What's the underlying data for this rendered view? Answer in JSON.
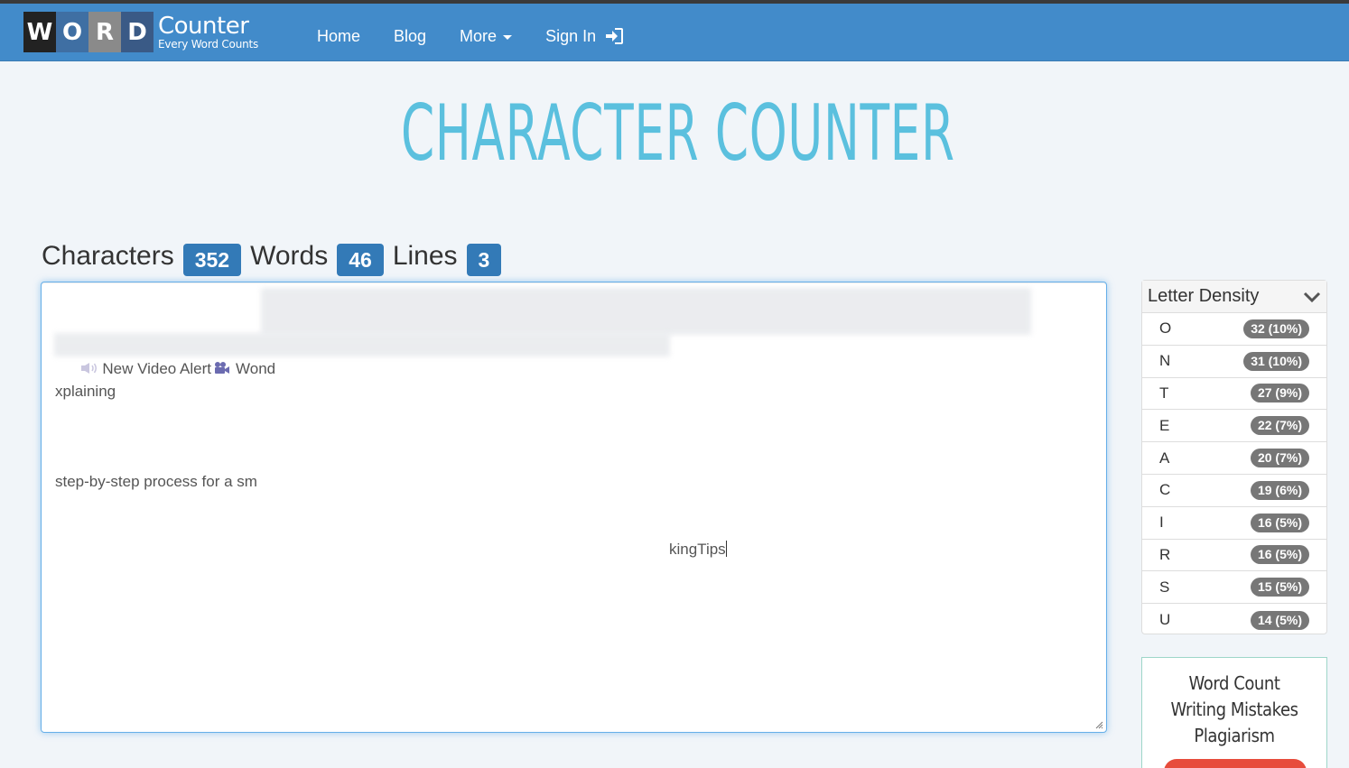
{
  "brand": {
    "tiles": [
      "W",
      "O",
      "R",
      "D"
    ],
    "name": "Counter",
    "tagline": "Every Word Counts"
  },
  "nav": {
    "home": "Home",
    "blog": "Blog",
    "more": "More",
    "signin": "Sign In"
  },
  "page": {
    "title": "CHARACTER COUNTER"
  },
  "stats": {
    "characters_label": "Characters",
    "characters_value": "352",
    "words_label": "Words",
    "words_value": "46",
    "lines_label": "Lines",
    "lines_value": "3"
  },
  "editor": {
    "line1_start": "New Video Alert",
    "line1_partial": "Wond",
    "line1_end": "xplaining",
    "line2_start": "step-by-step process for a sm",
    "line3_end": "kingTips"
  },
  "density": {
    "title": "Letter Density",
    "rows": [
      {
        "letter": "O",
        "value": "32 (10%)"
      },
      {
        "letter": "N",
        "value": "31 (10%)"
      },
      {
        "letter": "T",
        "value": "27 (9%)"
      },
      {
        "letter": "E",
        "value": "22 (7%)"
      },
      {
        "letter": "A",
        "value": "20 (7%)"
      },
      {
        "letter": "C",
        "value": "19 (6%)"
      },
      {
        "letter": "I",
        "value": "16 (5%)"
      },
      {
        "letter": "R",
        "value": "16 (5%)"
      },
      {
        "letter": "S",
        "value": "15 (5%)"
      },
      {
        "letter": "U",
        "value": "14 (5%)"
      }
    ]
  },
  "promo": {
    "lines": [
      "Word Count",
      "Writing Mistakes",
      "Plagiarism"
    ]
  },
  "colors": {
    "navbar": "#428bca",
    "title": "#5bc0de",
    "stat_badge": "#337ab7",
    "density_badge": "#777777",
    "promo_button": "#e74c3c"
  }
}
